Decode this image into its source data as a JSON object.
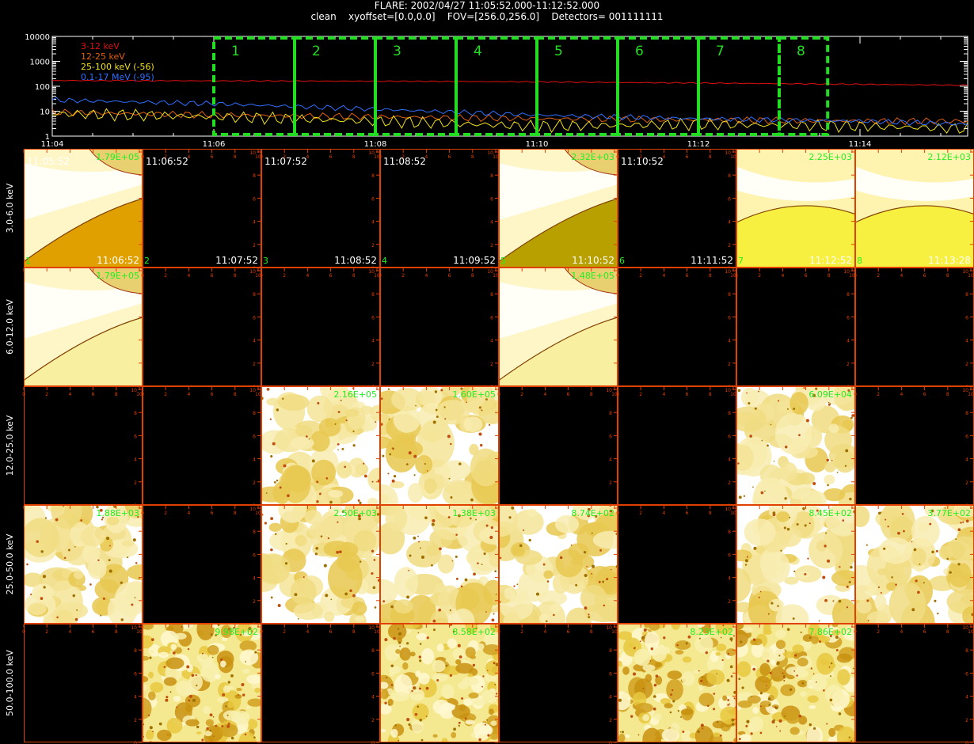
{
  "header": {
    "line1": "FLARE: 2002/04/27 11:05:52.000-11:12:52.000",
    "line2": "clean    xyoffset=[0.0,0.0]    FOV=[256.0,256.0]    Detectors= 001111111"
  },
  "chart_data": [
    {
      "type": "line",
      "title": "",
      "xlabel": "",
      "ylabel": "",
      "y_scale": "log",
      "ylim": [
        1,
        10000
      ],
      "y_ticks": [
        "10000",
        "1000",
        "100",
        "10",
        "1"
      ],
      "x_range": [
        "11:04",
        "11:15:20"
      ],
      "x_ticks": [
        "11:04",
        "11:06",
        "11:08",
        "11:10",
        "11:12",
        "11:14"
      ],
      "legend": "top-left",
      "series": [
        {
          "name": "3-12 keV",
          "color": "#e01010",
          "x": [
            "11:04",
            "11:06",
            "11:08",
            "11:10",
            "11:12",
            "11:14",
            "11:15:20"
          ],
          "values": [
            170,
            165,
            160,
            150,
            135,
            120,
            110
          ]
        },
        {
          "name": "12-25 keV",
          "color": "#e06010",
          "x": [
            "11:04",
            "11:06",
            "11:08",
            "11:10",
            "11:12",
            "11:14",
            "11:15:20"
          ],
          "values": [
            9,
            7,
            6,
            5,
            4.5,
            4,
            4
          ]
        },
        {
          "name": "25-100 keV (-56)",
          "color": "#f0e020",
          "x": [
            "11:04",
            "11:06",
            "11:08",
            "11:10",
            "11:12",
            "11:14",
            "11:15:20"
          ],
          "values": [
            8,
            6,
            4,
            2.5,
            3,
            2.5,
            2
          ]
        },
        {
          "name": "0.1-17 MeV (-95)",
          "color": "#3070ff",
          "x": [
            "11:04",
            "11:06",
            "11:08",
            "11:10",
            "11:12",
            "11:14",
            "11:15:20"
          ],
          "values": [
            28,
            20,
            12,
            7,
            5,
            4,
            3
          ]
        }
      ],
      "intervals": [
        {
          "label": "1",
          "start": "11:06",
          "end": "11:07"
        },
        {
          "label": "2",
          "start": "11:07",
          "end": "11:08"
        },
        {
          "label": "3",
          "start": "11:08",
          "end": "11:09"
        },
        {
          "label": "4",
          "start": "11:09",
          "end": "11:10"
        },
        {
          "label": "5",
          "start": "11:10",
          "end": "11:11"
        },
        {
          "label": "6",
          "start": "11:11",
          "end": "11:12"
        },
        {
          "label": "7",
          "start": "11:12",
          "end": "11:13"
        },
        {
          "label": "8",
          "start": "11:13",
          "end": "11:13:36"
        }
      ],
      "interval_color": "#22dd22"
    },
    {
      "type": "heatmap",
      "title": "",
      "row_labels": [
        "3.0-6.0 keV",
        "6.0-12.0 keV",
        "12.0-25.0 keV",
        "25.0-50.0 keV",
        "50.0-100.0 keV"
      ],
      "columns": 8,
      "panel_ticks": [
        "0",
        "2",
        "4",
        "6",
        "8",
        "10"
      ],
      "panels": [
        {
          "row": 0,
          "col": 0,
          "style": "smooth",
          "base": "#e0a000",
          "peak": "1.79E+05",
          "start": "11:05:52",
          "end": "11:06:52",
          "num": "1"
        },
        {
          "row": 0,
          "col": 1,
          "style": "empty",
          "start": "11:06:52",
          "end": "11:07:52",
          "num": "2"
        },
        {
          "row": 0,
          "col": 2,
          "style": "empty",
          "start": "11:07:52",
          "end": "11:08:52",
          "num": "3"
        },
        {
          "row": 0,
          "col": 3,
          "style": "empty",
          "start": "11:08:52",
          "end": "11:09:52",
          "num": "4"
        },
        {
          "row": 0,
          "col": 4,
          "style": "smooth",
          "base": "#b8a000",
          "peak": "2.32E+03",
          "end": "11:10:52",
          "num": "5"
        },
        {
          "row": 0,
          "col": 5,
          "style": "empty",
          "start": "11:10:52",
          "end": "11:11:52",
          "num": "6"
        },
        {
          "row": 0,
          "col": 6,
          "style": "band",
          "base": "#f8f040",
          "peak": "2.25E+03",
          "end": "11:12:52",
          "num": "7"
        },
        {
          "row": 0,
          "col": 7,
          "style": "band",
          "base": "#f8f040",
          "peak": "2.12E+03",
          "end": "11:13:28",
          "num": "8"
        },
        {
          "row": 1,
          "col": 0,
          "style": "smooth",
          "base": "#f8f0a0",
          "peak": "1.79E+05"
        },
        {
          "row": 1,
          "col": 1,
          "style": "empty"
        },
        {
          "row": 1,
          "col": 2,
          "style": "empty"
        },
        {
          "row": 1,
          "col": 3,
          "style": "empty"
        },
        {
          "row": 1,
          "col": 4,
          "style": "smooth",
          "base": "#f8f0a0",
          "peak": "1.48E+05"
        },
        {
          "row": 1,
          "col": 5,
          "style": "empty"
        },
        {
          "row": 1,
          "col": 6,
          "style": "empty"
        },
        {
          "row": 1,
          "col": 7,
          "style": "empty"
        },
        {
          "row": 2,
          "col": 0,
          "style": "empty"
        },
        {
          "row": 2,
          "col": 1,
          "style": "empty"
        },
        {
          "row": 2,
          "col": 2,
          "style": "noise",
          "peak": "2.16E+05"
        },
        {
          "row": 2,
          "col": 3,
          "style": "noise",
          "peak": "1.60E+05"
        },
        {
          "row": 2,
          "col": 4,
          "style": "empty"
        },
        {
          "row": 2,
          "col": 5,
          "style": "empty"
        },
        {
          "row": 2,
          "col": 6,
          "style": "noise",
          "peak": "6.09E+04"
        },
        {
          "row": 2,
          "col": 7,
          "style": "empty"
        },
        {
          "row": 3,
          "col": 0,
          "style": "noise",
          "peak": "1.88E+03"
        },
        {
          "row": 3,
          "col": 1,
          "style": "empty"
        },
        {
          "row": 3,
          "col": 2,
          "style": "noise",
          "peak": "2.50E+03"
        },
        {
          "row": 3,
          "col": 3,
          "style": "noise",
          "peak": "1.38E+03"
        },
        {
          "row": 3,
          "col": 4,
          "style": "noise",
          "peak": "8.74E+02"
        },
        {
          "row": 3,
          "col": 5,
          "style": "empty"
        },
        {
          "row": 3,
          "col": 6,
          "style": "noise",
          "peak": "8.45E+02"
        },
        {
          "row": 3,
          "col": 7,
          "style": "noise",
          "peak": "3.77E+02"
        },
        {
          "row": 4,
          "col": 0,
          "style": "empty"
        },
        {
          "row": 4,
          "col": 1,
          "style": "dense",
          "peak": "9.98E+02"
        },
        {
          "row": 4,
          "col": 2,
          "style": "empty"
        },
        {
          "row": 4,
          "col": 3,
          "style": "dense",
          "peak": "8.58E+02"
        },
        {
          "row": 4,
          "col": 4,
          "style": "empty"
        },
        {
          "row": 4,
          "col": 5,
          "style": "dense",
          "peak": "8.23E+02"
        },
        {
          "row": 4,
          "col": 6,
          "style": "dense",
          "peak": "7.86E+02"
        },
        {
          "row": 4,
          "col": 7,
          "style": "empty"
        }
      ]
    }
  ],
  "colors": {
    "axis": "#e04000",
    "label_green": "#22ee22",
    "text": "#ffffff"
  }
}
